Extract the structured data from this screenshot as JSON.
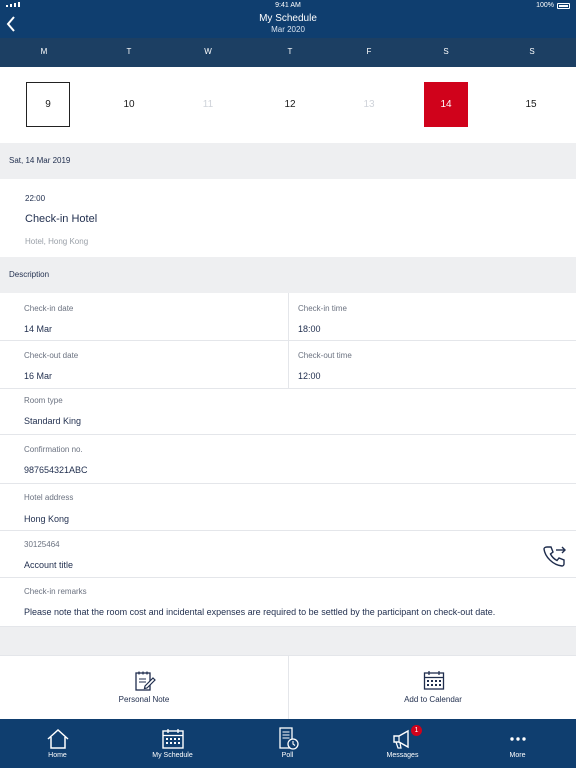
{
  "status_bar": {
    "time": "9:41 AM",
    "battery": "100%"
  },
  "header": {
    "title": "My Schedule",
    "subtitle": "Mar 2020"
  },
  "week": {
    "days": [
      "M",
      "T",
      "W",
      "T",
      "F",
      "S",
      "S"
    ],
    "dates": [
      {
        "label": "9",
        "state": "today"
      },
      {
        "label": "10",
        "state": "normal"
      },
      {
        "label": "11",
        "state": "dim"
      },
      {
        "label": "12",
        "state": "normal"
      },
      {
        "label": "13",
        "state": "dim"
      },
      {
        "label": "14",
        "state": "selected"
      },
      {
        "label": "15",
        "state": "normal"
      }
    ]
  },
  "selected_date": "Sat, 14 Mar 2019",
  "event": {
    "time": "22:00",
    "title": "Check-in Hotel",
    "location": "Hotel, Hong Kong"
  },
  "description": {
    "heading": "Description",
    "check_in_date": {
      "label": "Check-in date",
      "value": "14 Mar"
    },
    "check_in_time": {
      "label": "Check-in time",
      "value": "18:00"
    },
    "check_out_date": {
      "label": "Check-out date",
      "value": "16 Mar"
    },
    "check_out_time": {
      "label": "Check-out time",
      "value": "12:00"
    },
    "room_type": {
      "label": "Room type",
      "value": "Standard King"
    },
    "confirmation": {
      "label": "Confirmation no.",
      "value": "987654321ABC"
    },
    "hotel_address": {
      "label": "Hotel address",
      "value": "Hong Kong"
    },
    "account": {
      "label": "30125464",
      "value": "Account title"
    },
    "remarks": {
      "label": "Check-in remarks",
      "value": "Please note that the room cost and incidental expenses are required to be settled by the participant on check-out date."
    }
  },
  "actions": {
    "personal_note": "Personal Note",
    "add_to_calendar": "Add to Calendar"
  },
  "tabs": [
    {
      "label": "Home",
      "icon": "home-icon"
    },
    {
      "label": "My Schedule",
      "icon": "calendar-icon"
    },
    {
      "label": "Poll",
      "icon": "poll-icon"
    },
    {
      "label": "Messages",
      "icon": "megaphone-icon",
      "badge": "1"
    },
    {
      "label": "More",
      "icon": "more-icon"
    }
  ],
  "colors": {
    "header": "#0f3e6f",
    "week_header": "#1c3f63",
    "selected": "#d0021b"
  }
}
